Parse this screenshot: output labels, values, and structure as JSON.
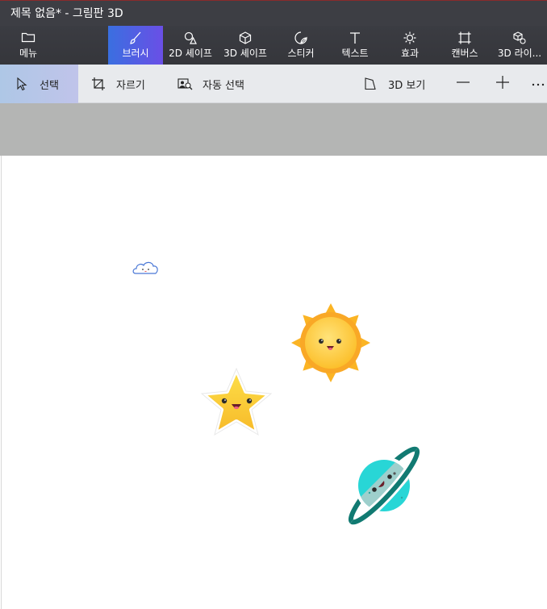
{
  "window": {
    "title": "제목 없음* - 그림판 3D"
  },
  "ribbon": {
    "menu": {
      "label": "메뉴",
      "icon": "folder-icon"
    },
    "tabs": [
      {
        "label": "브러시",
        "icon": "brush-icon",
        "active": true
      },
      {
        "label": "2D 셰이프",
        "icon": "shapes-2d-icon",
        "active": false
      },
      {
        "label": "3D 셰이프",
        "icon": "cube-icon",
        "active": false
      },
      {
        "label": "스티커",
        "icon": "sticker-icon",
        "active": false
      },
      {
        "label": "텍스트",
        "icon": "text-icon",
        "active": false
      },
      {
        "label": "효과",
        "icon": "sun-effects-icon",
        "active": false
      },
      {
        "label": "캔버스",
        "icon": "canvas-icon",
        "active": false
      },
      {
        "label": "3D 라이...",
        "icon": "library-3d-icon",
        "active": false
      }
    ]
  },
  "toolbar": {
    "select": "선택",
    "crop": "자르기",
    "magic_select": "자동 선택",
    "view3d": "3D 보기",
    "zoom_out_icon": "minus-icon",
    "zoom_in_icon": "plus-icon",
    "more_icon": "more-icon"
  },
  "canvas": {
    "stickers": [
      "cloud-sticker",
      "sun-sticker",
      "star-sticker",
      "planet-sticker"
    ]
  },
  "colors": {
    "accent_start": "#3a6fe0",
    "accent_end": "#6a4fe6",
    "ribbon_bg": "#3b3c42",
    "toolbar_bg": "#e8eaed",
    "canvas_surround": "#b4b5b4"
  }
}
